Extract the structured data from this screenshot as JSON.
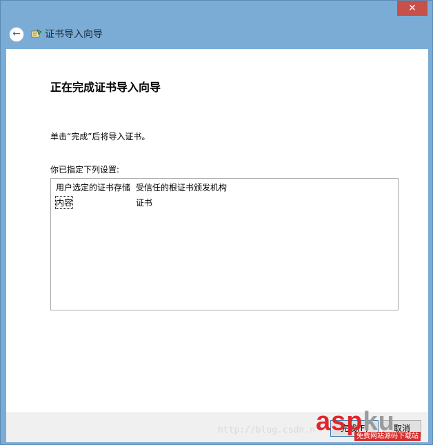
{
  "window": {
    "close_glyph": "✕"
  },
  "header": {
    "back_icon": "back-arrow-icon",
    "wizard_icon": "certificate-wizard-icon",
    "title": "证书导入向导"
  },
  "content": {
    "heading": "正在完成证书导入向导",
    "instruction": "单击“完成”后将导入证书。",
    "settings_label": "你已指定下列设置:",
    "settings": [
      {
        "key": "用户选定的证书存储",
        "value": "受信任的根证书颁发机构"
      },
      {
        "key": "内容",
        "value": "证书"
      }
    ]
  },
  "footer": {
    "finish_label": "完成(F)",
    "cancel_label": "取消"
  },
  "watermark": {
    "url": "http://blog.csdn.n",
    "logo_text_a": "asp",
    "logo_text_b": "ku",
    "logo_suffix": ".com",
    "logo_tagline": "免费网站源码下载站"
  },
  "colors": {
    "titlebar": "#7aacd6",
    "close": "#c7504a",
    "logo_red": "#e1262b"
  }
}
